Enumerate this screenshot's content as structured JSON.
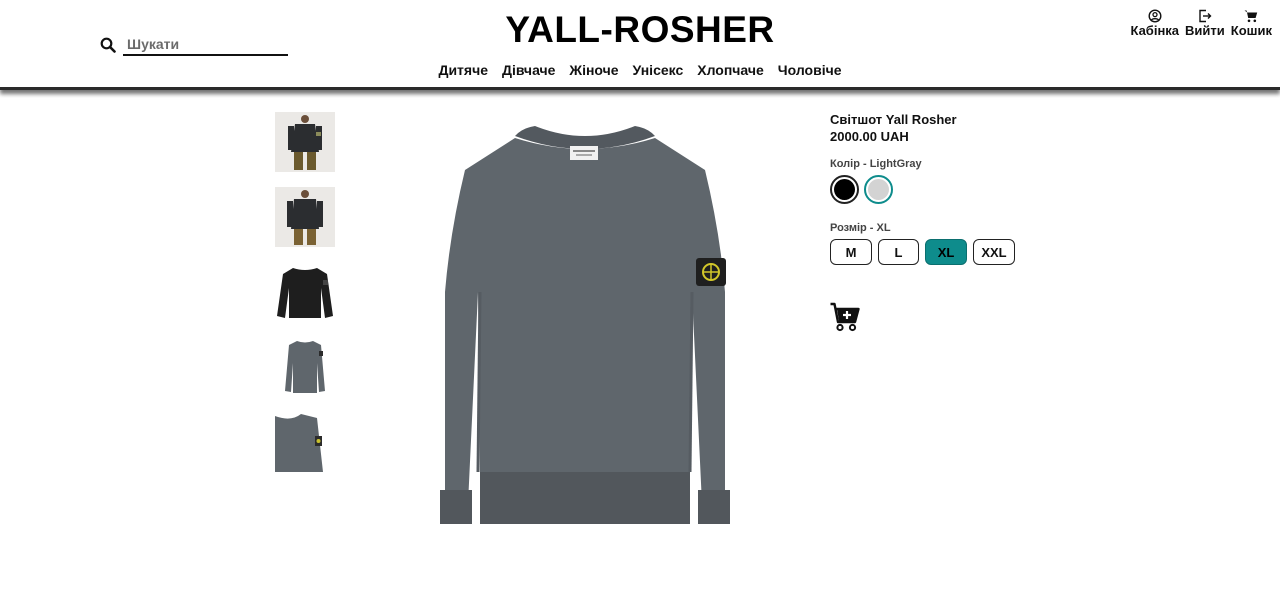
{
  "header": {
    "logo": "YALL-ROSHER",
    "search": {
      "placeholder": "Шукати",
      "value": ""
    },
    "nav": [
      "Дитяче",
      "Дівчаче",
      "Жіноче",
      "Унісекс",
      "Хлопчаче",
      "Чоловіче"
    ],
    "actions": [
      {
        "label": "Кабінка",
        "icon": "user-circle-icon"
      },
      {
        "label": "Вийти",
        "icon": "logout-icon"
      },
      {
        "label": "Кошик",
        "icon": "cart-icon"
      }
    ]
  },
  "product": {
    "title": "Світшот Yall Rosher",
    "price": "2000.00 UAH",
    "color_label": "Колір - LightGray",
    "colors": [
      {
        "name": "Black",
        "hex": "#000000",
        "selected": false
      },
      {
        "name": "LightGray",
        "hex": "#d3d3d3",
        "selected": true
      }
    ],
    "size_label": "Розмір - XL",
    "sizes": [
      {
        "label": "M",
        "selected": false
      },
      {
        "label": "L",
        "selected": false
      },
      {
        "label": "XL",
        "selected": true
      },
      {
        "label": "XXL",
        "selected": false
      }
    ],
    "thumbnails": [
      "model-front-dark",
      "model-back-dark",
      "sweater-black",
      "sweater-gray-small",
      "sweater-gray-crop"
    ]
  },
  "colors": {
    "accent": "#0e8c8c",
    "sweater_gray": "#5f666c",
    "sweater_dark": "#2b2d30"
  }
}
